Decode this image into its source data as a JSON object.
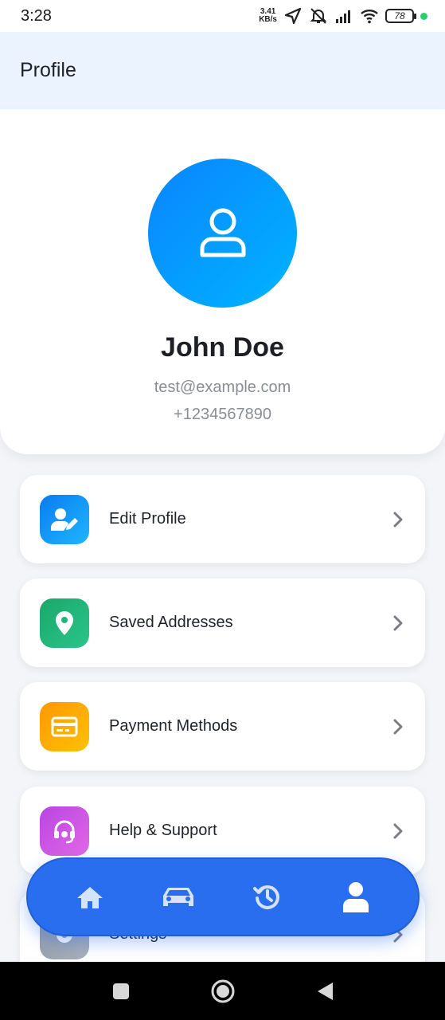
{
  "status_bar": {
    "time": "3:28",
    "speed_value": "3.41",
    "speed_unit": "KB/s",
    "battery": "78",
    "icons": [
      "navigation-icon",
      "mute-icon",
      "signal-icon",
      "wifi-icon",
      "battery-icon"
    ]
  },
  "app_bar": {
    "title": "Profile"
  },
  "profile": {
    "name": "John Doe",
    "email": "test@example.com",
    "phone": "+1234567890",
    "avatar_icon": "user-icon"
  },
  "menu": [
    {
      "label": "Edit Profile",
      "icon": "user-edit-icon",
      "color_from": "#0a7cf0",
      "color_to": "#1fb6ff"
    },
    {
      "label": "Saved Addresses",
      "icon": "location-pin-icon",
      "color_from": "#1aa86a",
      "color_to": "#2bc48a"
    },
    {
      "label": "Payment Methods",
      "icon": "credit-card-icon",
      "color_from": "#ff9800",
      "color_to": "#ffc107"
    },
    {
      "label": "Help & Support",
      "icon": "headset-icon",
      "color_from": "#b845e0",
      "color_to": "#e368e6"
    },
    {
      "label": "Settings",
      "icon": "gear-icon",
      "color_from": "#8e97a4",
      "color_to": "#a9b0bb"
    }
  ],
  "bottom_nav": [
    {
      "name": "home",
      "icon": "home-icon"
    },
    {
      "name": "rides",
      "icon": "car-icon"
    },
    {
      "name": "history",
      "icon": "history-icon"
    },
    {
      "name": "profile",
      "icon": "profile-icon",
      "active": true
    }
  ],
  "colors": {
    "accent": "#2a6ef0",
    "app_bar_bg": "#ebf3fe",
    "avatar_gradient": [
      "#0a84ff",
      "#00b4ff"
    ]
  }
}
